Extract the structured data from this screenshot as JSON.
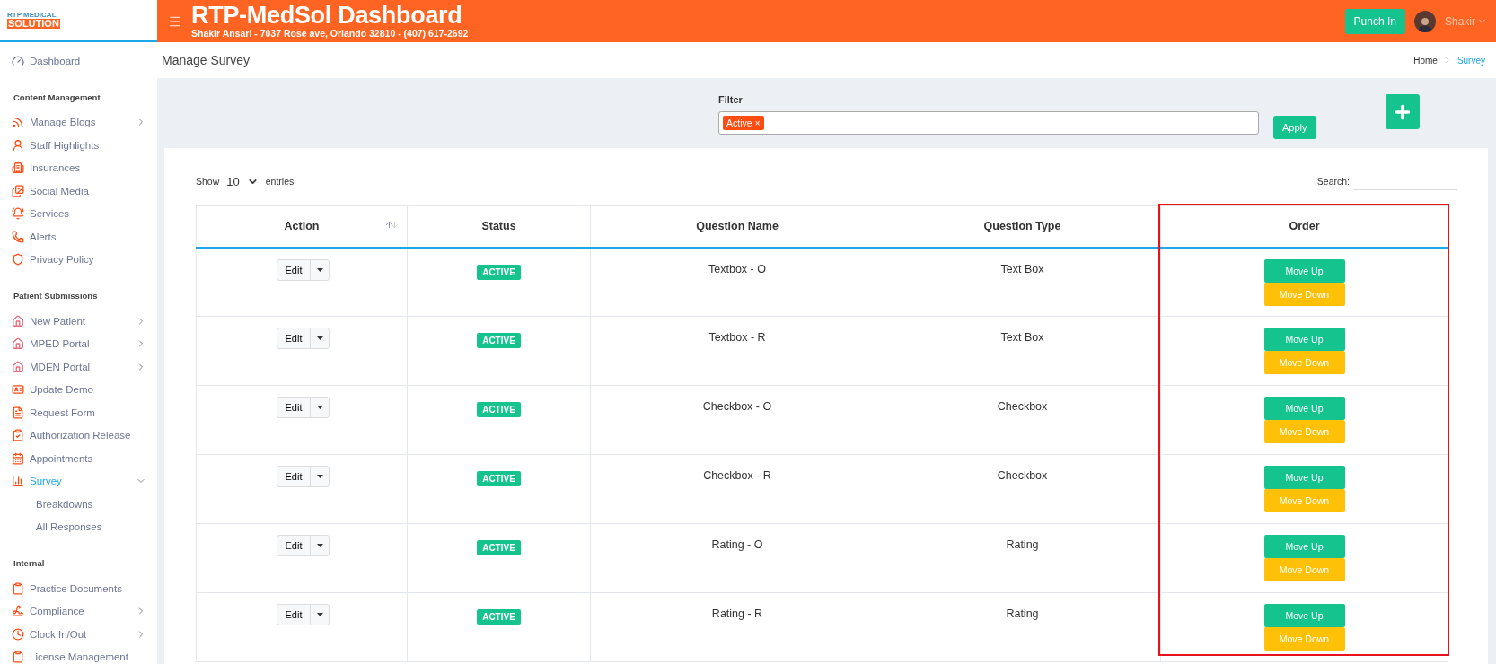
{
  "logo": {
    "line1": "RTP MEDICAL",
    "line2": "SOLUTION"
  },
  "header": {
    "title": "RTP-MedSol Dashboard",
    "subtitle": "Shakir Ansari - 7037 Rose ave, Orlando 32810 - (407) 617-2692",
    "punch_button": "Punch In",
    "user": "Shakir"
  },
  "sidebar": {
    "top_item": {
      "label": "Dashboard",
      "kind": "gauge",
      "selected": false
    },
    "sections": [
      {
        "heading": "Content Management",
        "items": [
          {
            "label": "Manage Blogs",
            "kind": "rss",
            "has_submenu": true,
            "selected": false
          },
          {
            "label": "Staff Highlights",
            "kind": "user",
            "has_submenu": false,
            "selected": false
          },
          {
            "label": "Insurances",
            "kind": "building",
            "has_submenu": false,
            "selected": false
          },
          {
            "label": "Social Media",
            "kind": "images",
            "has_submenu": false,
            "selected": false
          },
          {
            "label": "Services",
            "kind": "bell",
            "has_submenu": false,
            "selected": false
          },
          {
            "label": "Alerts",
            "kind": "phone",
            "has_submenu": false,
            "selected": false
          },
          {
            "label": "Privacy Policy",
            "kind": "shield",
            "has_submenu": false,
            "selected": false
          }
        ]
      },
      {
        "heading": "Patient Submissions",
        "items": [
          {
            "label": "New Patient",
            "kind": "house",
            "has_submenu": true,
            "selected": false
          },
          {
            "label": "MPED Portal",
            "kind": "house",
            "has_submenu": true,
            "selected": false
          },
          {
            "label": "MDEN Portal",
            "kind": "house",
            "has_submenu": true,
            "selected": false
          },
          {
            "label": "Update Demo",
            "kind": "idcard",
            "has_submenu": false,
            "selected": false
          },
          {
            "label": "Request Form",
            "kind": "file",
            "has_submenu": false,
            "selected": false
          },
          {
            "label": "Authorization Release",
            "kind": "clipcheck",
            "has_submenu": false,
            "selected": false
          },
          {
            "label": "Appointments",
            "kind": "calendar",
            "has_submenu": false,
            "selected": false
          },
          {
            "label": "Survey",
            "kind": "chart",
            "has_submenu": true,
            "expanded": true,
            "selected": true,
            "children": [
              {
                "label": "Breakdowns"
              },
              {
                "label": "All Responses"
              }
            ]
          }
        ]
      },
      {
        "heading": "Internal",
        "items": [
          {
            "label": "Practice Documents",
            "kind": "clipboard",
            "has_submenu": false,
            "selected": false
          },
          {
            "label": "Compliance",
            "kind": "signature",
            "has_submenu": true,
            "selected": false
          },
          {
            "label": "Clock In/Out",
            "kind": "clock",
            "has_submenu": true,
            "selected": false
          },
          {
            "label": "License Management",
            "kind": "clipboard",
            "has_submenu": false,
            "selected": false
          }
        ]
      }
    ]
  },
  "page": {
    "title": "Manage Survey",
    "breadcrumb": [
      {
        "label": "Home",
        "selected": false
      },
      {
        "label": "Survey",
        "selected": true
      }
    ]
  },
  "filter": {
    "label": "Filter",
    "tags": [
      "Active"
    ],
    "tag_remove": "×",
    "apply_button": "Apply"
  },
  "table_controls": {
    "show_label": "Show",
    "page_size": "10",
    "entries_label": "entries",
    "search_label": "Search:"
  },
  "table": {
    "columns": [
      {
        "label": "Action",
        "sortable": true
      },
      {
        "label": "Status",
        "sortable": false
      },
      {
        "label": "Question Name",
        "sortable": false
      },
      {
        "label": "Question Type",
        "sortable": false
      },
      {
        "label": "Order",
        "sortable": false,
        "highlighted": true
      }
    ],
    "rows": [
      {
        "action": "Edit",
        "status": "ACTIVE",
        "question_name": "Textbox - O",
        "question_type": "Text Box",
        "move_up": "Move Up",
        "move_down": "Move Down"
      },
      {
        "action": "Edit",
        "status": "ACTIVE",
        "question_name": "Textbox - R",
        "question_type": "Text Box",
        "move_up": "Move Up",
        "move_down": "Move Down"
      },
      {
        "action": "Edit",
        "status": "ACTIVE",
        "question_name": "Checkbox - O",
        "question_type": "Checkbox",
        "move_up": "Move Up",
        "move_down": "Move Down"
      },
      {
        "action": "Edit",
        "status": "ACTIVE",
        "question_name": "Checkbox - R",
        "question_type": "Checkbox",
        "move_up": "Move Up",
        "move_down": "Move Down"
      },
      {
        "action": "Edit",
        "status": "ACTIVE",
        "question_name": "Rating - O",
        "question_type": "Rating",
        "move_up": "Move Up",
        "move_down": "Move Down"
      },
      {
        "action": "Edit",
        "status": "ACTIVE",
        "question_name": "Rating - R",
        "question_type": "Rating",
        "move_up": "Move Up",
        "move_down": "Move Down"
      }
    ]
  }
}
